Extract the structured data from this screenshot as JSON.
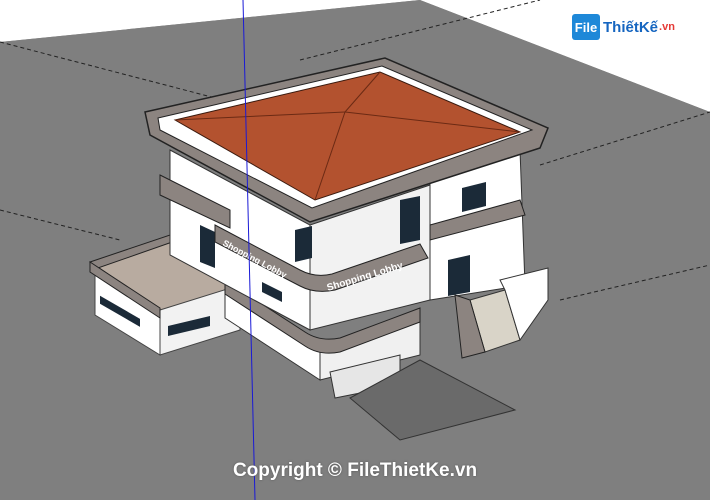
{
  "watermark": {
    "logo_badge": "File",
    "logo_text": "ThiếtKế",
    "logo_tld": ".vn",
    "copyright": "Copyright © FileThietKe.vn"
  },
  "building": {
    "sign_lower": "Shopping Lobby",
    "sign_upper": "Shopping Lobby"
  },
  "colors": {
    "sky": "#ffffff",
    "ground": "#7f7f7f",
    "roof": "#b3522f",
    "wall": "#ffffff",
    "trim": "#8c8480",
    "axis_blue": "#1a1ad6"
  }
}
